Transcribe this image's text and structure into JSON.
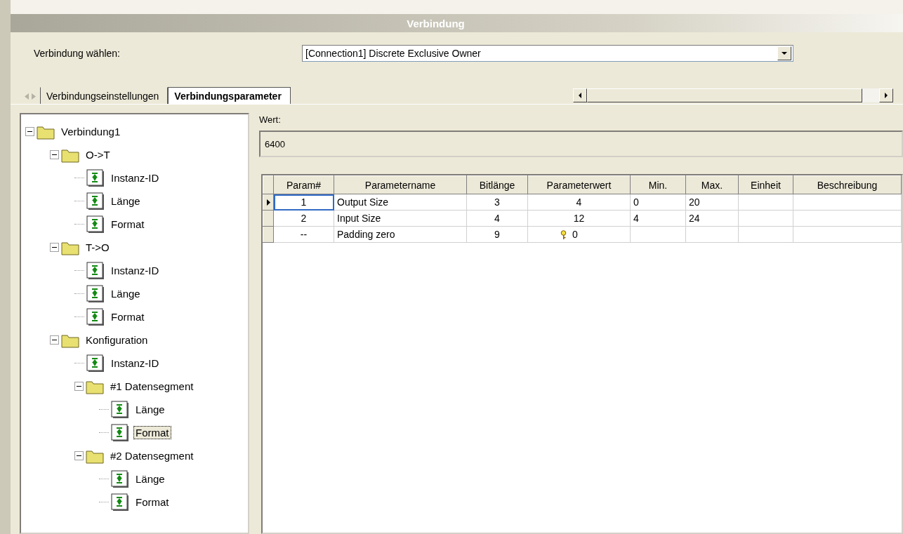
{
  "header": {
    "title": "Verbindung"
  },
  "connection_select": {
    "label": "Verbindung wählen:",
    "value": "[Connection1] Discrete Exclusive Owner"
  },
  "tabs": [
    {
      "label": "Verbindungseinstellungen",
      "selected": false
    },
    {
      "label": "Verbindungsparameter",
      "selected": true
    }
  ],
  "tree": [
    {
      "label": "Verbindung1",
      "kind": "folder",
      "expanded": true,
      "selected": false,
      "children": [
        {
          "label": "O->T",
          "kind": "folder",
          "expanded": true,
          "selected": false,
          "children": [
            {
              "label": "Instanz-ID",
              "kind": "param",
              "selected": false
            },
            {
              "label": "Länge",
              "kind": "param",
              "selected": false
            },
            {
              "label": "Format",
              "kind": "param",
              "selected": false
            }
          ]
        },
        {
          "label": "T->O",
          "kind": "folder",
          "expanded": true,
          "selected": false,
          "children": [
            {
              "label": "Instanz-ID",
              "kind": "param",
              "selected": false
            },
            {
              "label": "Länge",
              "kind": "param",
              "selected": false
            },
            {
              "label": "Format",
              "kind": "param",
              "selected": false
            }
          ]
        },
        {
          "label": "Konfiguration",
          "kind": "folder",
          "expanded": true,
          "selected": false,
          "children": [
            {
              "label": "Instanz-ID",
              "kind": "param",
              "selected": false
            },
            {
              "label": "#1 Datensegment",
              "kind": "folder",
              "expanded": true,
              "selected": false,
              "children": [
                {
                  "label": "Länge",
                  "kind": "param",
                  "selected": false
                },
                {
                  "label": "Format",
                  "kind": "param",
                  "selected": true
                }
              ]
            },
            {
              "label": "#2 Datensegment",
              "kind": "folder",
              "expanded": true,
              "selected": false,
              "children": [
                {
                  "label": "Länge",
                  "kind": "param",
                  "selected": false
                },
                {
                  "label": "Format",
                  "kind": "param",
                  "selected": false
                }
              ]
            }
          ]
        }
      ]
    }
  ],
  "value_field": {
    "label": "Wert:",
    "value": "6400"
  },
  "table": {
    "columns": [
      "Param#",
      "Parametername",
      "Bitlänge",
      "Parameterwert",
      "Min.",
      "Max.",
      "Einheit",
      "Beschreibung"
    ],
    "rows": [
      {
        "selected": true,
        "locked": false,
        "cells": [
          "1",
          "Output Size",
          "3",
          "4",
          "0",
          "20",
          "",
          ""
        ]
      },
      {
        "selected": false,
        "locked": false,
        "cells": [
          "2",
          "Input Size",
          "4",
          "12",
          "4",
          "24",
          "",
          ""
        ]
      },
      {
        "selected": false,
        "locked": true,
        "cells": [
          "--",
          "Padding zero",
          "9",
          "0",
          "",
          "",
          "",
          ""
        ]
      }
    ]
  }
}
